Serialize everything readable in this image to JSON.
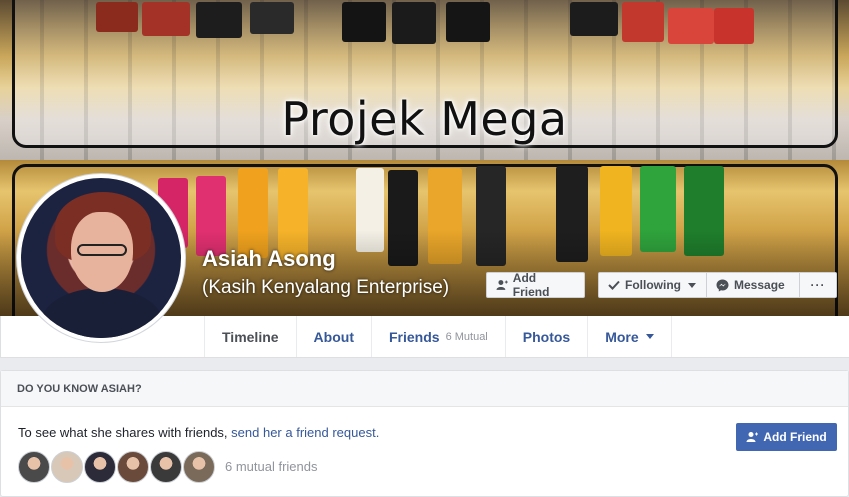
{
  "cover": {
    "title": "Projek Mega"
  },
  "profile": {
    "name": "Asiah Asong",
    "alternate_name": "(Kasih Kenyalang Enterprise)"
  },
  "actions": {
    "add_friend": "Add Friend",
    "following": "Following",
    "message": "Message",
    "more": "···"
  },
  "nav": {
    "timeline": "Timeline",
    "about": "About",
    "friends": "Friends",
    "friends_mutual": "6 Mutual",
    "photos": "Photos",
    "more": "More"
  },
  "know_card": {
    "header": "DO YOU KNOW ASIAH?",
    "text": "To see what she shares with friends, ",
    "link": "send her a friend request.",
    "button": "Add Friend",
    "mutual_friends": "6 mutual friends",
    "avatar_colors": [
      "#4a4a4a",
      "#d8c8b8",
      "#2b2b3a",
      "#6a4a3a",
      "#3a3a3a",
      "#7a6a5a"
    ]
  },
  "colors": {
    "link": "#365899",
    "primary": "#4267b2"
  }
}
